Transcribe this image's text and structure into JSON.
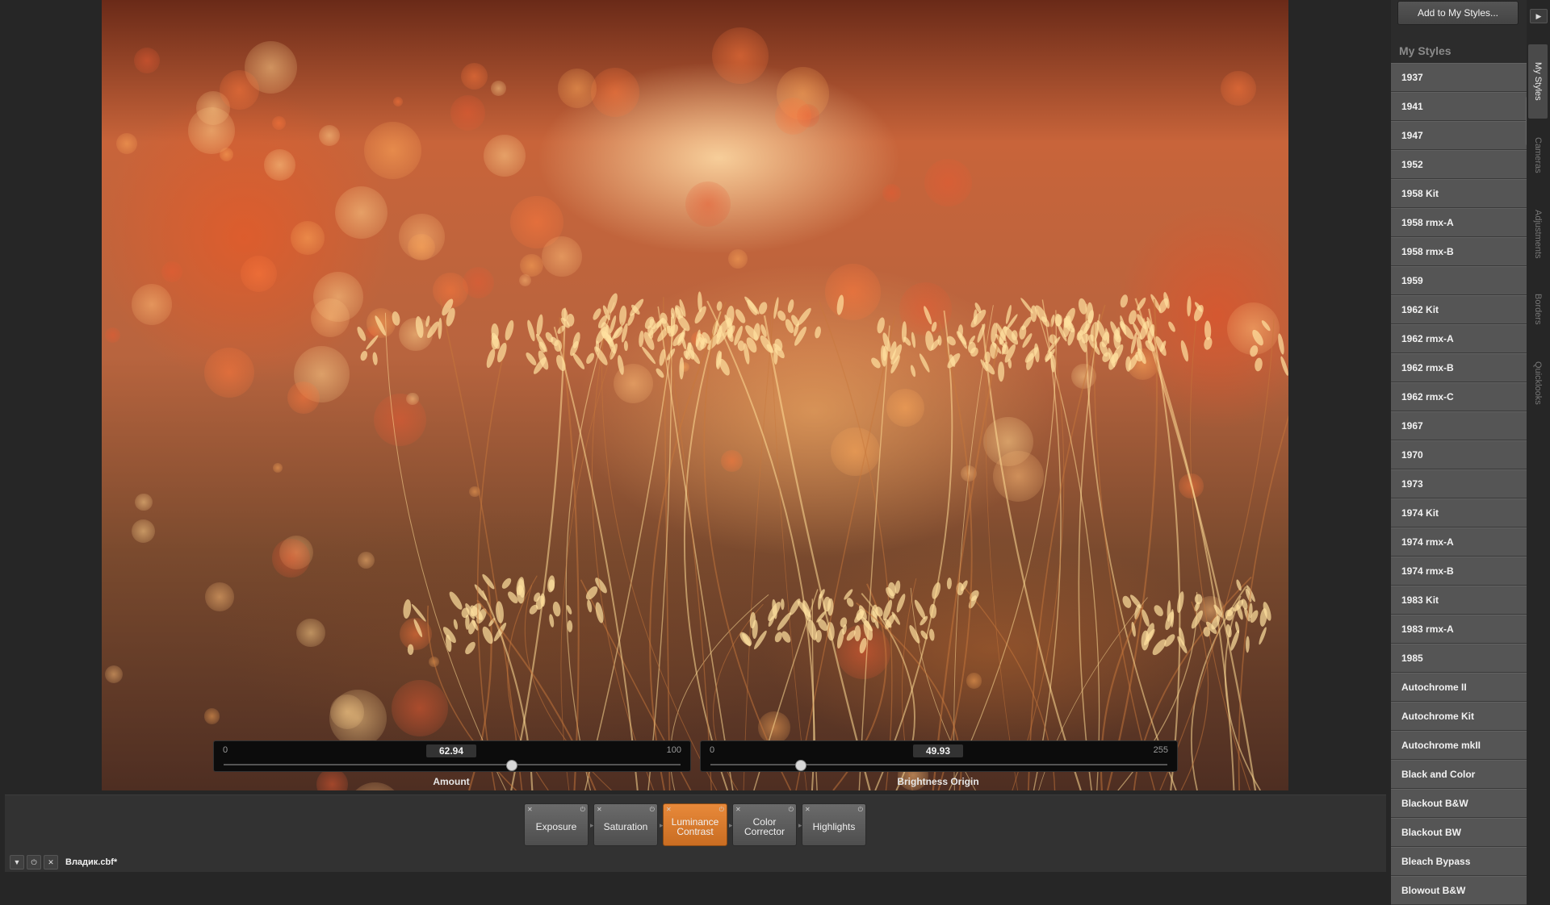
{
  "sliders": [
    {
      "min": "0",
      "max": "100",
      "value": "62.94",
      "fraction": 0.6294,
      "label": "Amount"
    },
    {
      "min": "0",
      "max": "255",
      "value": "49.93",
      "fraction": 0.1958,
      "label": "Brightness Origin"
    }
  ],
  "modules": [
    {
      "label": "Exposure",
      "active": false
    },
    {
      "label": "Saturation",
      "active": false
    },
    {
      "label": "Luminance\nContrast",
      "active": true
    },
    {
      "label": "Color\nCorrector",
      "active": false
    },
    {
      "label": "Highlights",
      "active": false
    }
  ],
  "file": {
    "name": "Владик.cbf*"
  },
  "right_panel": {
    "add_button": "Add to My Styles...",
    "section_title": "My Styles",
    "styles": [
      "1937",
      "1941",
      "1947",
      "1952",
      "1958 Kit",
      "1958 rmx-A",
      "1958 rmx-B",
      "1959",
      "1962 Kit",
      "1962 rmx-A",
      "1962 rmx-B",
      "1962 rmx-C",
      "1967",
      "1970",
      "1973",
      "1974 Kit",
      "1974 rmx-A",
      "1974 rmx-B",
      "1983 Kit",
      "1983 rmx-A",
      "1985",
      "Autochrome II",
      "Autochrome Kit",
      "Autochrome mkII",
      "Black and Color",
      "Blackout B&W",
      "Blackout BW",
      "Bleach Bypass",
      "Blowout B&W"
    ]
  },
  "side_tabs": [
    {
      "label": "My Styles",
      "active": true
    },
    {
      "label": "Cameras",
      "active": false
    },
    {
      "label": "Adjustments",
      "active": false
    },
    {
      "label": "Borders",
      "active": false
    },
    {
      "label": "Quicklooks",
      "active": false
    }
  ],
  "icons": {
    "dropdown": "triangle-down",
    "power": "power",
    "close": "x",
    "collapse": "triangle-right"
  },
  "colors": {
    "accent": "#e07f32",
    "panel": "#2c2c2c",
    "list_item": "#555555"
  }
}
